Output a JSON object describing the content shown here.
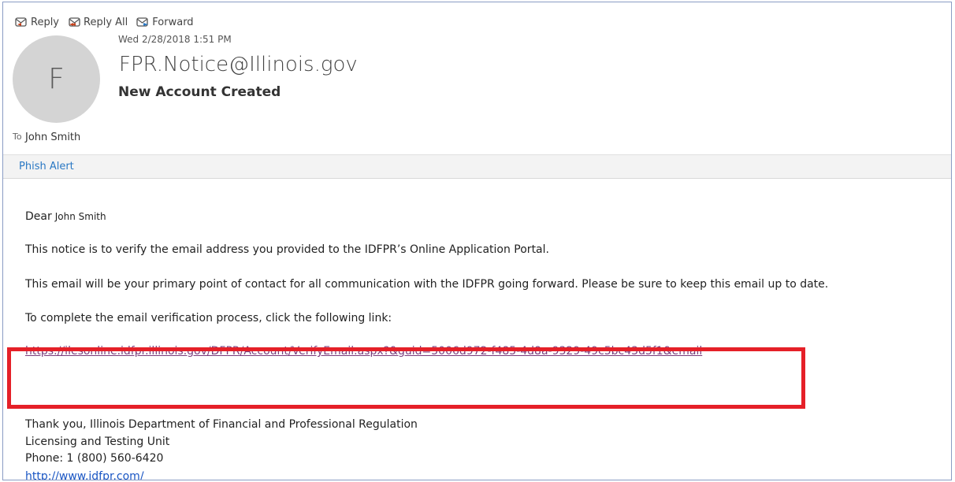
{
  "toolbar": {
    "reply": "Reply",
    "reply_all": "Reply All",
    "forward": "Forward"
  },
  "message": {
    "date": "Wed 2/28/2018 1:51 PM",
    "avatar_letter": "F",
    "sender": "FPR.Notice@Illinois.gov",
    "subject": "New Account Created",
    "to_label": "To",
    "to_name": "John Smith"
  },
  "phish_alert": "Phish Alert",
  "body": {
    "greeting": "Dear",
    "greeting_name": "John Smith",
    "line1": "This notice is to verify the email address you provided to the IDFPR’s Online Application Portal.",
    "line2": "This email will be your primary point of contact for all communication with the IDFPR going forward. Please be sure to keep this email up to date.",
    "line3": "To complete the email verification process, click the following link:",
    "verify_link": "https://ilesonline.idfpr.illinois.gov/DFPR/Account/VerifyEmail.aspx?&guid=5006d972-f485-4d8a-9329-49c5bc43d5f1&email",
    "signoff": "Thank you, Illinois Department of Financial and Professional Regulation",
    "unit": "Licensing and Testing Unit",
    "phone": "Phone: 1 (800) 560-6420",
    "website": "http://www.idfpr.com/"
  },
  "colors": {
    "highlight": "#e52028",
    "link": "#7b3d7c",
    "phish_alert": "#2a78c4"
  }
}
